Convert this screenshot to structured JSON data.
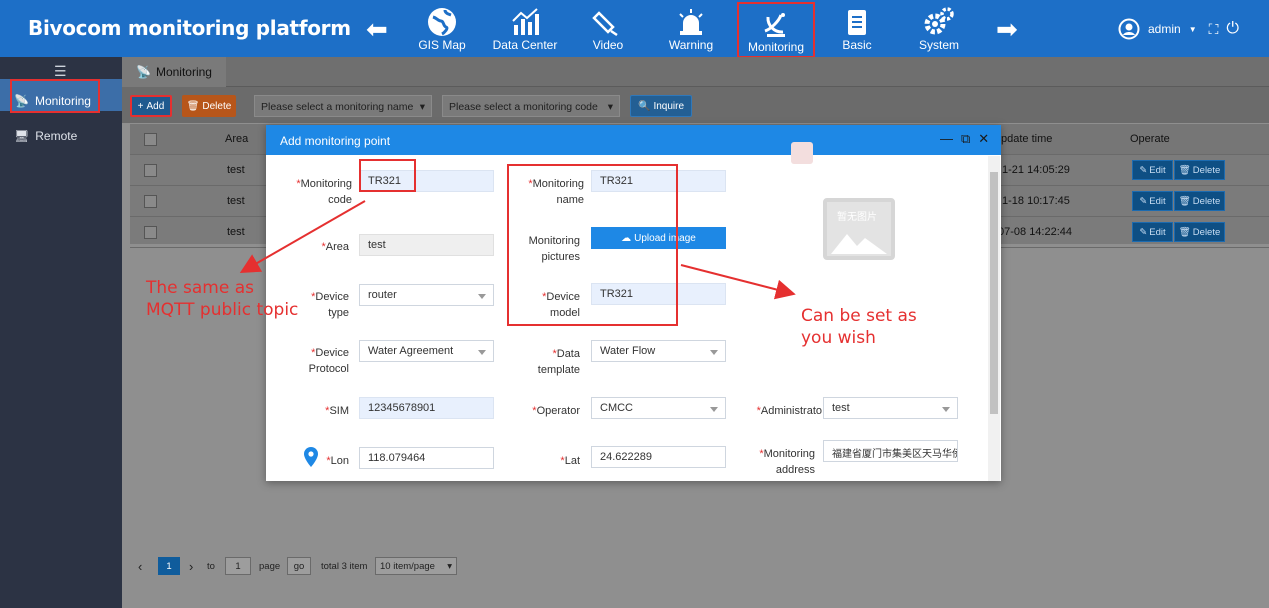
{
  "brand": "Bivocom monitoring platform",
  "nav": [
    {
      "label": "GIS Map",
      "icon": "globe-icon"
    },
    {
      "label": "Data Center",
      "icon": "chart-icon"
    },
    {
      "label": "Video",
      "icon": "camera-icon"
    },
    {
      "label": "Warning",
      "icon": "alarm-icon"
    },
    {
      "label": "Monitoring",
      "icon": "satellite-dish-icon"
    },
    {
      "label": "Basic",
      "icon": "clipboard-icon"
    },
    {
      "label": "System",
      "icon": "gears-icon"
    }
  ],
  "user": {
    "name": "admin"
  },
  "sidebar": {
    "items": [
      {
        "label": "Monitoring"
      },
      {
        "label": "Remote"
      }
    ]
  },
  "tab": {
    "label": "Monitoring"
  },
  "toolbar": {
    "add_label": "Add",
    "delete_label": "Delete",
    "name_placeholder": "Please select a monitoring name",
    "code_placeholder": "Please select a monitoring code",
    "inquire_label": "Inquire"
  },
  "table": {
    "headers": {
      "area": "Area",
      "update_time": "pdate time",
      "operate": "Operate"
    },
    "rows": [
      {
        "area": "test",
        "time": "1-21 14:05:29"
      },
      {
        "area": "test",
        "time": "1-18 10:17:45"
      },
      {
        "area": "test",
        "time": "07-08 14:22:44"
      }
    ],
    "edit_label": "Edit",
    "delete_label": "Delete"
  },
  "pager": {
    "current": "1",
    "to_label": "to",
    "page_input": "1",
    "page_label": "page",
    "go_label": "go",
    "total": "total 3 item",
    "per_page": "10 item/page"
  },
  "modal": {
    "title": "Add monitoring point",
    "fields": {
      "monitoring_code": {
        "label": "Monitoring code",
        "value": "TR321"
      },
      "monitoring_name": {
        "label": "Monitoring name",
        "value": "TR321"
      },
      "area": {
        "label": "Area",
        "value": "test"
      },
      "monitoring_pictures": {
        "label": "Monitoring pictures",
        "button": "Upload image"
      },
      "device_type": {
        "label": "Device type",
        "value": "router"
      },
      "device_model": {
        "label": "Device model",
        "value": "TR321"
      },
      "device_protocol": {
        "label": "Device Protocol",
        "value": "Water Agreement"
      },
      "data_template": {
        "label": "Data template",
        "value": "Water Flow"
      },
      "sim": {
        "label": "SIM",
        "value": "12345678901"
      },
      "operator": {
        "label": "Operator",
        "value": "CMCC"
      },
      "administrator": {
        "label": "Administrato",
        "value": "test"
      },
      "lon": {
        "label": "Lon",
        "value": "118.079464"
      },
      "lat": {
        "label": "Lat",
        "value": "24.622289"
      },
      "monitoring_address": {
        "label": "Monitoring address",
        "value": "福建省厦门市集美区天马华侨"
      }
    },
    "no_image_text": "暂无图片"
  },
  "annotations": {
    "left": "The same as MQTT public topic",
    "right": "Can be set as you wish"
  },
  "colors": {
    "topbar": "#1d6fc7",
    "accent": "#1e88e5",
    "highlight": "#e53030",
    "sidebar": "#2c3344"
  }
}
